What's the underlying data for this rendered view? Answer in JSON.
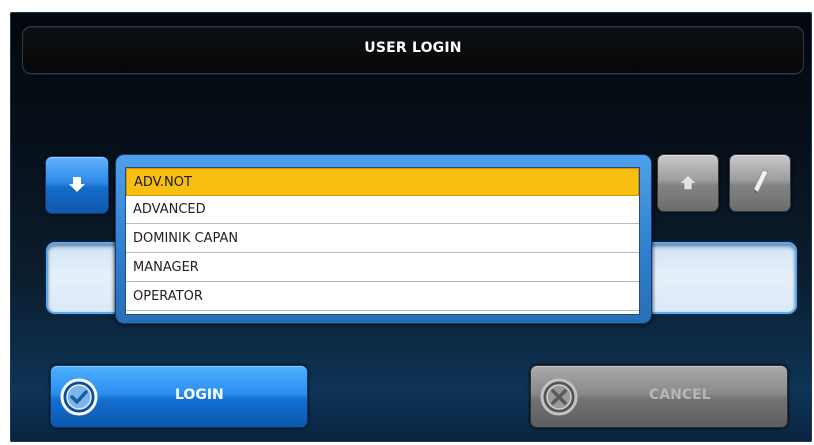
{
  "dialog": {
    "title": "USER LOGIN"
  },
  "user_list": {
    "items": [
      "ADV.NOT",
      "ADVANCED",
      "DOMINIK CAPAN",
      "MANAGER",
      "OPERATOR"
    ],
    "selected": "ADV.NOT"
  },
  "password": {
    "value": ""
  },
  "buttons": {
    "login_label": "LOGIN",
    "cancel_label": "CANCEL"
  },
  "icons": {
    "down": "arrow-down-icon",
    "up": "arrow-up-icon",
    "edit": "pencil-icon",
    "login": "checkmark-circle-icon",
    "cancel": "x-circle-icon"
  },
  "colors": {
    "accent_blue": "#2b8fef",
    "selected_row": "#f8be10",
    "disabled_grey": "#8a8a8a"
  }
}
